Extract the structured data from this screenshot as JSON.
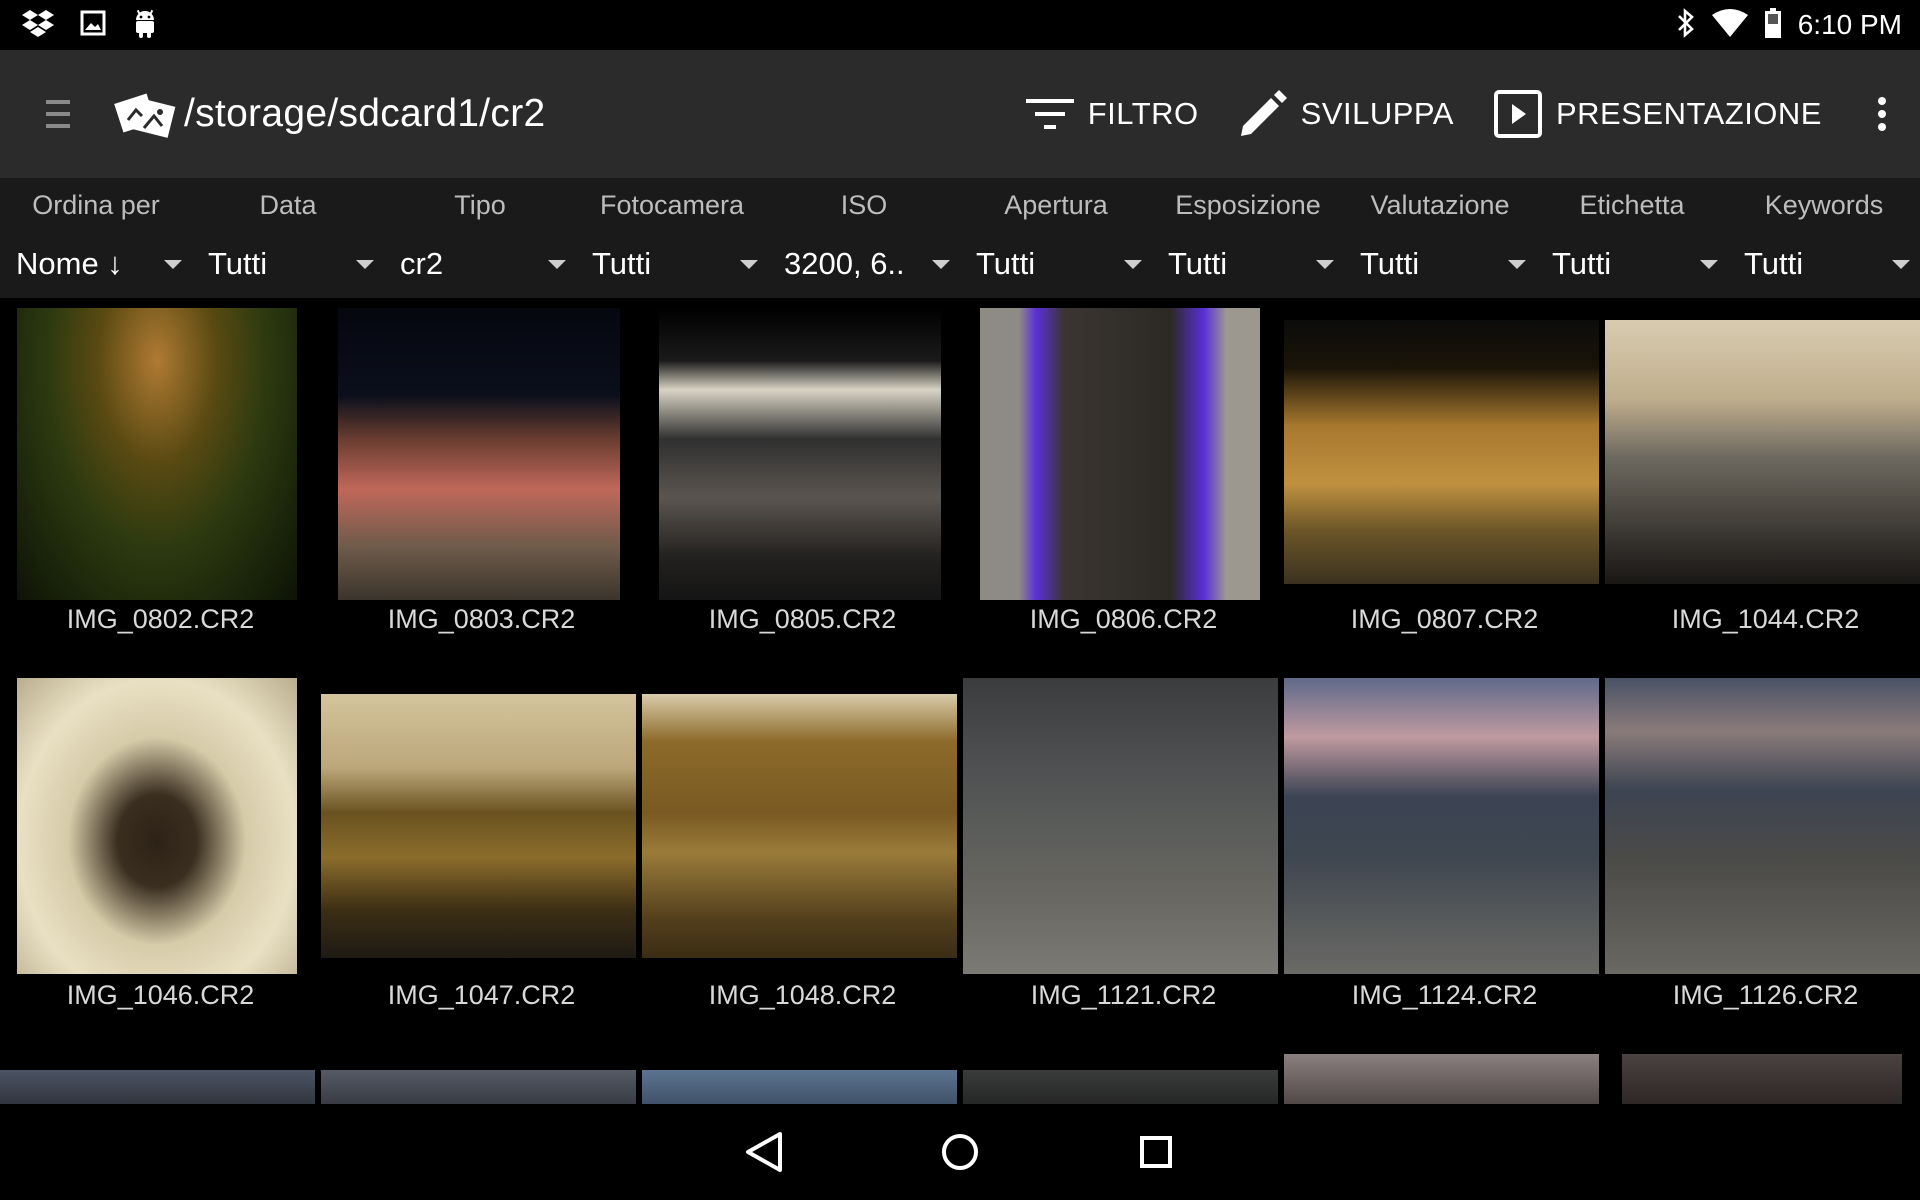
{
  "status_bar": {
    "time": "6:10 PM",
    "left_icons": [
      "dropbox-icon",
      "image-icon",
      "android-icon"
    ],
    "right_icons": [
      "bluetooth-icon",
      "wifi-icon",
      "battery-icon"
    ]
  },
  "toolbar": {
    "path": "/storage/sdcard1/cr2",
    "actions": {
      "filter": "FILTRO",
      "develop": "SVILUPPA",
      "slideshow": "PRESENTAZIONE"
    }
  },
  "filters": [
    {
      "header": "Ordina per",
      "value": "Nome ↓"
    },
    {
      "header": "Data",
      "value": "Tutti"
    },
    {
      "header": "Tipo",
      "value": "cr2"
    },
    {
      "header": "Fotocamera",
      "value": "Tutti"
    },
    {
      "header": "ISO",
      "value": "3200, 6.."
    },
    {
      "header": "Apertura",
      "value": "Tutti"
    },
    {
      "header": "Esposizione",
      "value": "Tutti"
    },
    {
      "header": "Valutazione",
      "value": "Tutti"
    },
    {
      "header": "Etichetta",
      "value": "Tutti"
    },
    {
      "header": "Keywords",
      "value": "Tutti"
    }
  ],
  "images": [
    {
      "name": "IMG_0802.CR2"
    },
    {
      "name": "IMG_0803.CR2"
    },
    {
      "name": "IMG_0805.CR2"
    },
    {
      "name": "IMG_0806.CR2"
    },
    {
      "name": "IMG_0807.CR2"
    },
    {
      "name": "IMG_1044.CR2"
    },
    {
      "name": "IMG_1046.CR2"
    },
    {
      "name": "IMG_1047.CR2"
    },
    {
      "name": "IMG_1048.CR2"
    },
    {
      "name": "IMG_1121.CR2"
    },
    {
      "name": "IMG_1124.CR2"
    },
    {
      "name": "IMG_1126.CR2"
    }
  ],
  "nav_bar": [
    "back-icon",
    "home-icon",
    "recents-icon"
  ]
}
